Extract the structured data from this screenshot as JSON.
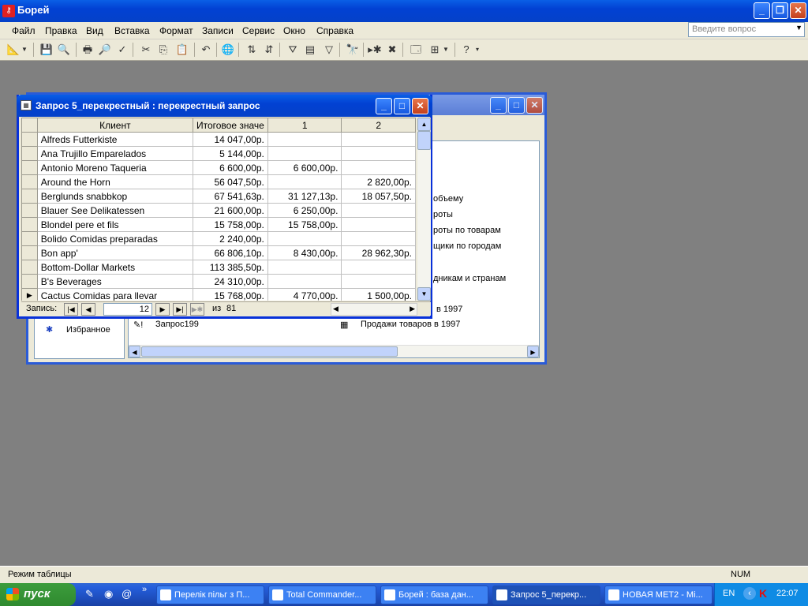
{
  "app": {
    "title": "Борей",
    "help_placeholder": "Введите вопрос"
  },
  "menu": [
    "Файл",
    "Правка",
    "Вид",
    "Вставка",
    "Формат",
    "Записи",
    "Сервис",
    "Окно",
    "Справка"
  ],
  "db_window": {
    "items_right": [
      "объему",
      "роты",
      "роты по товарам",
      "щики по городам",
      "дникам и странам",
      "в 1997",
      "Продажи товаров в 1997"
    ],
    "item_left": "Запрос199",
    "favorites": "Избранное"
  },
  "query_window": {
    "title": "Запрос 5_перекрестный : перекрестный запрос",
    "columns": [
      "Клиент",
      "Итоговое значе",
      "1",
      "2"
    ],
    "rows": [
      [
        "Alfreds Futterkiste",
        "14 047,00р.",
        "",
        ""
      ],
      [
        "Ana Trujillo Emparelados",
        "5 144,00р.",
        "",
        ""
      ],
      [
        "Antonio Moreno Taqueria",
        "6 600,00р.",
        "6 600,00р.",
        ""
      ],
      [
        "Around the Horn",
        "56 047,50р.",
        "",
        "2 820,00р."
      ],
      [
        "Berglunds snabbkop",
        "67 541,63р.",
        "31 127,13р.",
        "18 057,50р."
      ],
      [
        "Blauer See Delikatessen",
        "21 600,00р.",
        "6 250,00р.",
        ""
      ],
      [
        "Blondel pere et fils",
        "15 758,00р.",
        "15 758,00р.",
        ""
      ],
      [
        "Bolido Comidas preparadas",
        "2 240,00р.",
        "",
        ""
      ],
      [
        "Bon app'",
        "66 806,10р.",
        "8 430,00р.",
        "28 962,30р."
      ],
      [
        "Bottom-Dollar Markets",
        "113 385,50р.",
        "",
        ""
      ],
      [
        "B's Beverages",
        "24 310,00р.",
        "",
        ""
      ],
      [
        "Cactus Comidas para llevar",
        "15 768,00р.",
        "4 770,00р.",
        "1 500,00р."
      ]
    ],
    "nav": {
      "label": "Запись:",
      "current": "12",
      "of_label": "из",
      "total": "81"
    }
  },
  "status": {
    "mode": "Режим таблицы",
    "num": "NUM"
  },
  "taskbar": {
    "start": "пуск",
    "tasks": [
      "Перелік пільг з П...",
      "Total Commander...",
      "Борей : база дан...",
      "Запрос 5_перекр...",
      "НОВАЯ МЕТ2 - Mi..."
    ],
    "lang": "EN",
    "time": "22:07"
  }
}
